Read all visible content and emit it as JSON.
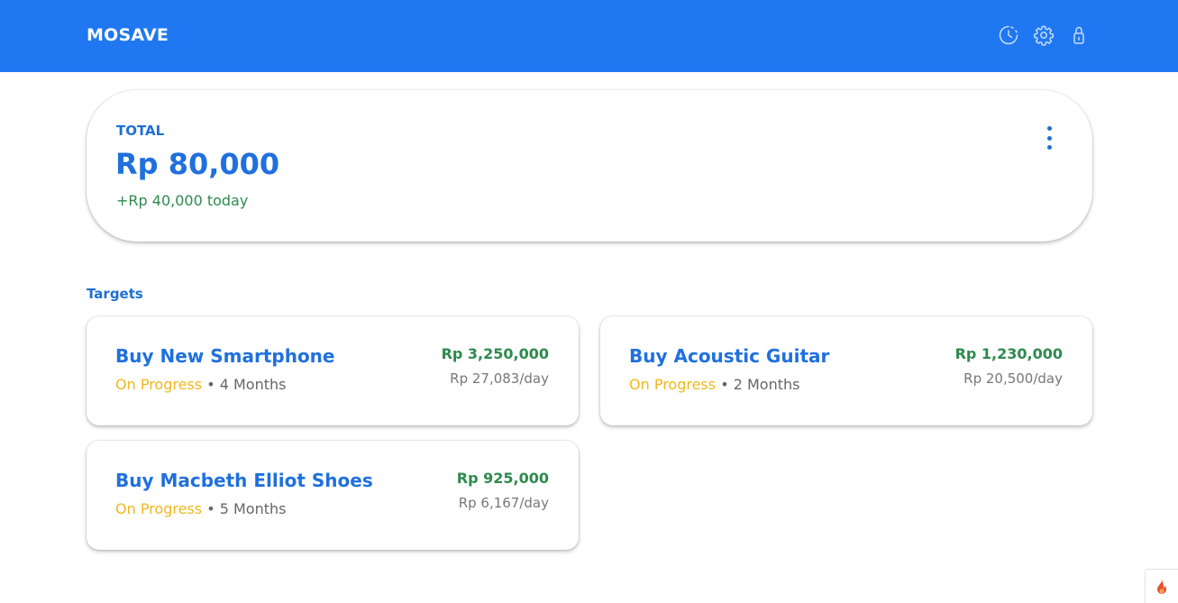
{
  "app": {
    "brand": "MOSAVE"
  },
  "nav": {
    "icons": [
      "history-icon",
      "settings-icon",
      "lock-icon"
    ]
  },
  "total": {
    "label": "TOTAL",
    "amount": "Rp 80,000",
    "today": "+Rp 40,000 today"
  },
  "targets": {
    "title": "Targets",
    "items": [
      {
        "title": "Buy New Smartphone",
        "status": "On Progress",
        "separator": " • ",
        "duration": "4 Months",
        "amount": "Rp 3,250,000",
        "per_day": "Rp 27,083/day"
      },
      {
        "title": "Buy Acoustic Guitar",
        "status": "On Progress",
        "separator": " • ",
        "duration": "2 Months",
        "amount": "Rp 1,230,000",
        "per_day": "Rp 20,500/day"
      },
      {
        "title": "Buy Macbeth Elliot Shoes",
        "status": "On Progress",
        "separator": " • ",
        "duration": "5 Months",
        "amount": "Rp 925,000",
        "per_day": "Rp 6,167/day"
      }
    ]
  },
  "colors": {
    "primary": "#1f78f2",
    "success": "#2e8a4e",
    "warning": "#f0b81c"
  }
}
